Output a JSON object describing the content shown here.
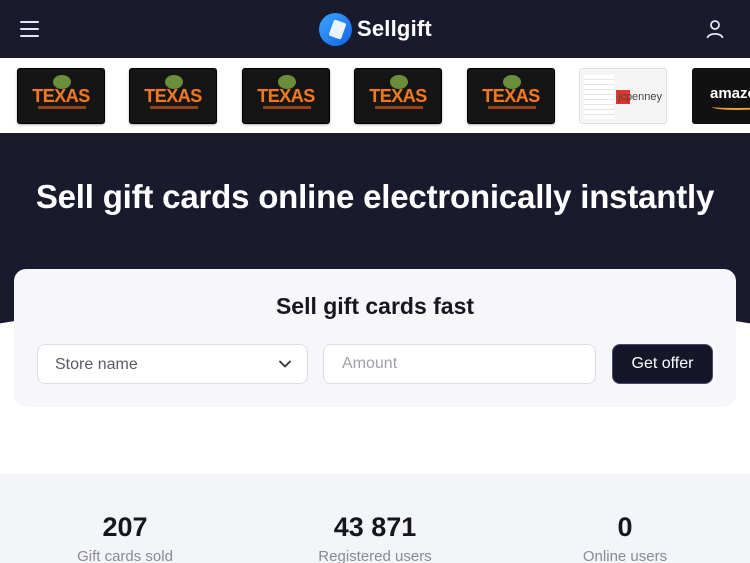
{
  "header": {
    "brand": "Sellgift",
    "menu_icon": "hamburger-menu-icon",
    "user_icon": "user-icon"
  },
  "carousel": {
    "cards": [
      {
        "brand": "TEXAS"
      },
      {
        "brand": "TEXAS"
      },
      {
        "brand": "TEXAS"
      },
      {
        "brand": "TEXAS"
      },
      {
        "brand": "TEXAS"
      },
      {
        "brand": "jcpenney"
      },
      {
        "brand": "amazon"
      }
    ]
  },
  "hero": {
    "title": "Sell gift cards online electronically instantly"
  },
  "form": {
    "title": "Sell gift cards fast",
    "store_placeholder": "Store name",
    "amount_placeholder": "Amount",
    "submit_label": "Get offer"
  },
  "stats": [
    {
      "value": "207",
      "label": "Gift cards sold"
    },
    {
      "value": "43 871",
      "label": "Registered users"
    },
    {
      "value": "0",
      "label": "Online users"
    }
  ],
  "colors": {
    "dark_bg": "#1a1a2e",
    "texas_orange": "#f07a22",
    "button_bg": "#16162a"
  }
}
